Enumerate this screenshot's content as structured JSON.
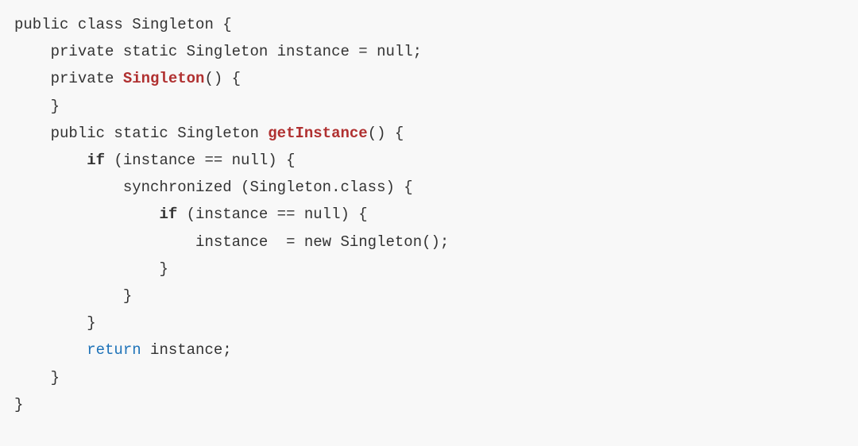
{
  "code": {
    "indent1": "    ",
    "indent2": "        ",
    "indent3": "            ",
    "indent4": "                ",
    "indent5": "                    ",
    "l1_a": "public class Singleton {",
    "l2_a": "private static Singleton instance = null;",
    "l3_a": "private ",
    "l3_fn": "Singleton",
    "l3_b": "() {",
    "l4_a": "}",
    "l5_a": "public static Singleton ",
    "l5_fn": "getInstance",
    "l5_b": "() {",
    "l6_kw": "if",
    "l6_a": " (instance == null) {",
    "l7_a": "synchronized (Singleton.class) {",
    "l8_kw": "if",
    "l8_a": " (instance == null) {",
    "l9_a": "instance  = new Singleton();",
    "l10_a": "}",
    "l11_a": "}",
    "l12_a": "}",
    "l13_kw": "return",
    "l13_a": " instance;",
    "l14_a": "}",
    "l15_a": "}"
  }
}
